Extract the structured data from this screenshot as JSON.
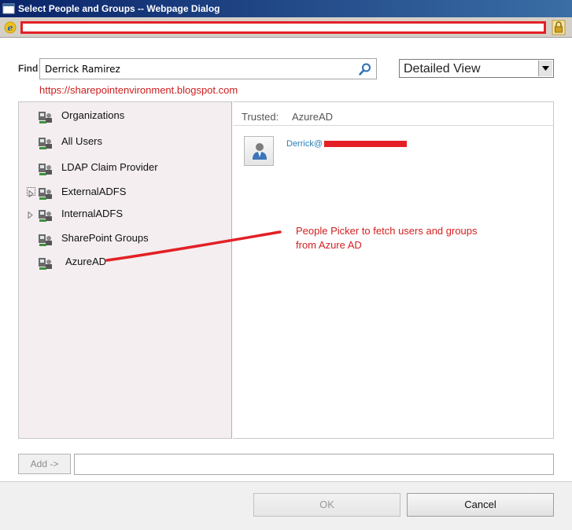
{
  "window": {
    "title": "Select People and Groups -- Webpage Dialog"
  },
  "find": {
    "label": "Find",
    "value": "Derrick Ramirez"
  },
  "view": {
    "selected": "Detailed View"
  },
  "watermark": "https://sharepointenvironment.blogspot.com",
  "tree": {
    "items": [
      {
        "label": "Organizations",
        "expandable": false
      },
      {
        "label": "All Users",
        "expandable": false
      },
      {
        "label": "LDAP Claim Provider",
        "expandable": false
      },
      {
        "label": "ExternalADFS",
        "expandable": true
      },
      {
        "label": "InternalADFS",
        "expandable": true
      },
      {
        "label": "SharePoint Groups",
        "expandable": false
      },
      {
        "label": "AzureAD",
        "expandable": false
      }
    ]
  },
  "results": {
    "header_label": "Trusted:",
    "header_value": "AzureAD",
    "user_display": "Derrick@"
  },
  "annotation": {
    "line1": "People Picker to fetch users and groups",
    "line2": "from Azure AD"
  },
  "footer": {
    "add_label": "Add ->",
    "ok_label": "OK",
    "cancel_label": "Cancel"
  },
  "colors": {
    "annotation": "#d42020",
    "redaction": "#e32026",
    "link": "#2a7db6"
  }
}
